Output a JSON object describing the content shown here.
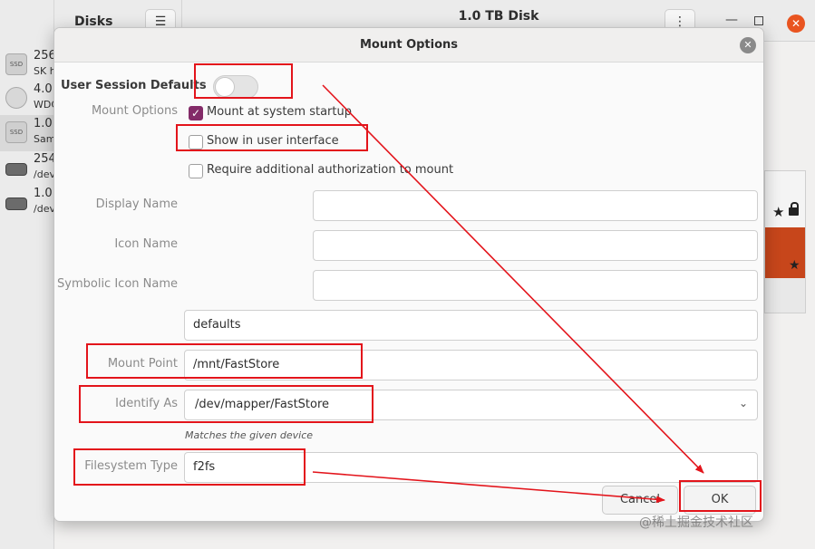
{
  "background": {
    "sidebar_title": "Disks",
    "main_title": "1.0 TB Disk",
    "menu_icon": "hamburger-menu-icon",
    "disks": [
      {
        "line1": "256",
        "line2": "SK h",
        "icon": "ssd-icon",
        "icon_text": "SSD"
      },
      {
        "line1": "4.0",
        "line2": "WDC",
        "icon": "optical-drive-icon",
        "icon_text": ""
      },
      {
        "line1": "1.0",
        "line2": "Sam",
        "icon": "ssd-icon",
        "icon_text": "SSD"
      },
      {
        "line1": "254",
        "line2": "/dev",
        "icon": "drive-icon",
        "icon_text": ""
      },
      {
        "line1": "1.0",
        "line2": "/dev",
        "icon": "drive-icon",
        "icon_text": ""
      }
    ],
    "partition_colors": {
      "selected": "#c7461b"
    }
  },
  "dialog": {
    "title": "Mount Options",
    "user_session_defaults_label": "User Session Defaults",
    "user_session_defaults_on": false,
    "mount_options_label": "Mount Options",
    "mount_at_startup": {
      "label": "Mount at system startup",
      "checked": true
    },
    "show_in_ui": {
      "label": "Show in user interface",
      "checked": false
    },
    "require_auth": {
      "label": "Require additional authorization to mount",
      "checked": false
    },
    "display_name_label": "Display Name",
    "display_name_value": "",
    "icon_name_label": "Icon Name",
    "icon_name_value": "",
    "symbolic_icon_name_label": "Symbolic Icon Name",
    "symbolic_icon_name_value": "",
    "options_value": "defaults",
    "mount_point_label": "Mount Point",
    "mount_point_value": "/mnt/FastStore",
    "identify_as_label": "Identify As",
    "identify_as_value": "/dev/mapper/FastStore",
    "identify_hint": "Matches the given device",
    "filesystem_type_label": "Filesystem Type",
    "filesystem_type_value": "f2fs",
    "cancel_label": "Cancel",
    "ok_label": "OK",
    "accent_color": "#832b68"
  },
  "annotations": {
    "color": "#e3141b"
  },
  "watermark": "@稀土掘金技术社区"
}
